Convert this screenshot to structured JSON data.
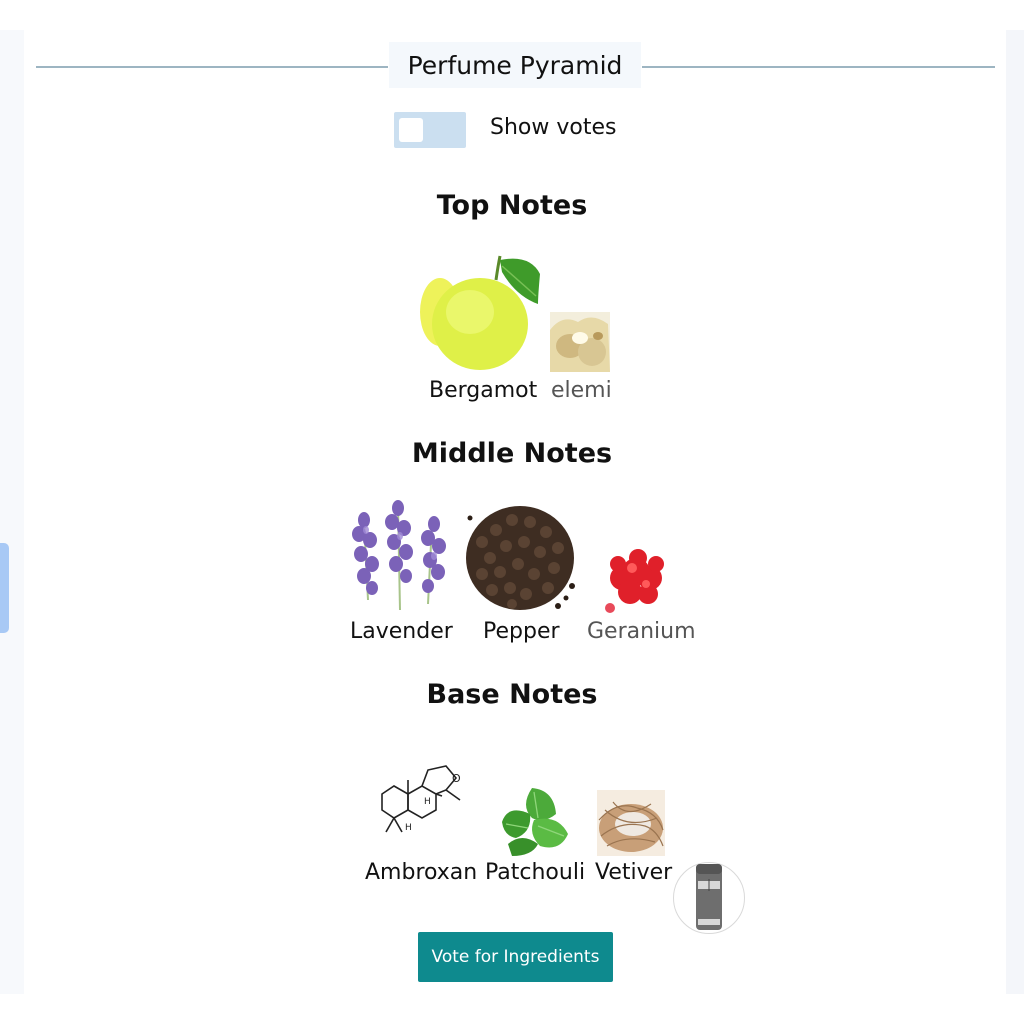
{
  "pyramid": {
    "title": "Perfume Pyramid",
    "show_votes_label": "Show votes",
    "show_votes_on": false
  },
  "sections": {
    "top": {
      "title": "Top Notes",
      "notes": [
        {
          "name": "Bergamot",
          "icon": "bergamot-image"
        },
        {
          "name": "elemi",
          "icon": "elemi-image"
        }
      ]
    },
    "middle": {
      "title": "Middle Notes",
      "notes": [
        {
          "name": "Lavender",
          "icon": "lavender-image"
        },
        {
          "name": "Pepper",
          "icon": "pepper-image"
        },
        {
          "name": "Geranium",
          "icon": "geranium-image"
        }
      ]
    },
    "base": {
      "title": "Base Notes",
      "notes": [
        {
          "name": "Ambroxan",
          "icon": "ambroxan-molecule-image"
        },
        {
          "name": "Patchouli",
          "icon": "patchouli-image"
        },
        {
          "name": "Vetiver",
          "icon": "vetiver-image"
        }
      ]
    }
  },
  "vote_button_label": "Vote for Ingredients",
  "colors": {
    "accent": "#0e8a8e",
    "toggle_track": "#cbdff0",
    "divider": "#9db5c2"
  }
}
